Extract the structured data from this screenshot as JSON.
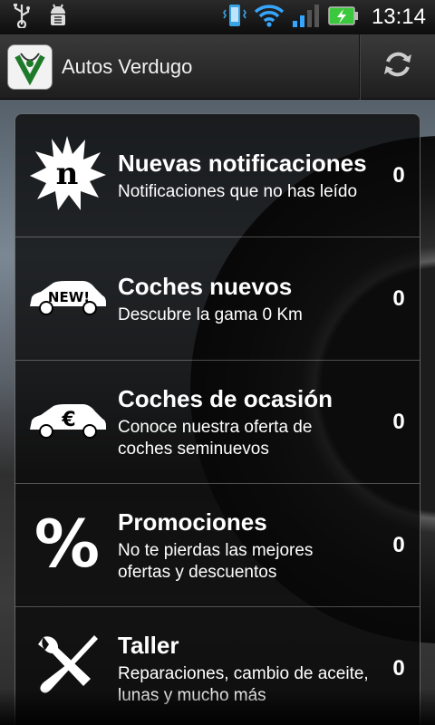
{
  "status_bar": {
    "time": "13:14",
    "left_icons": [
      "usb-icon",
      "android-debug-icon"
    ],
    "right_icons": [
      "vibrate-phone-icon",
      "wifi-icon",
      "signal-icon",
      "battery-charging-icon"
    ]
  },
  "app_bar": {
    "title": "Autos Verdugo",
    "logo_letter": "V",
    "refresh_icon": "refresh-icon"
  },
  "menu": {
    "items": [
      {
        "icon": "new-notification-star-icon",
        "icon_letter": "n",
        "title": "Nuevas notificaciones",
        "subtitle": "Notificaciones que no has leído",
        "count": "0"
      },
      {
        "icon": "new-car-icon",
        "icon_label": "NEW!",
        "title": "Coches nuevos",
        "subtitle": "Descubre la gama 0 Km",
        "count": "0"
      },
      {
        "icon": "used-car-euro-icon",
        "icon_label": "€",
        "title": "Coches de ocasión",
        "subtitle": "Conoce nuestra oferta de coches seminuevos",
        "count": "0"
      },
      {
        "icon": "percent-icon",
        "icon_label": "%",
        "title": "Promociones",
        "subtitle": "No te pierdas las mejores ofertas y descuentos",
        "count": "0"
      },
      {
        "icon": "tools-icon",
        "title": "Taller",
        "subtitle": "Reparaciones, cambio de aceite, lunas y mucho más",
        "count": "0"
      }
    ]
  },
  "colors": {
    "accent_green": "#2e7d32",
    "battery_green": "#3cc83c"
  }
}
